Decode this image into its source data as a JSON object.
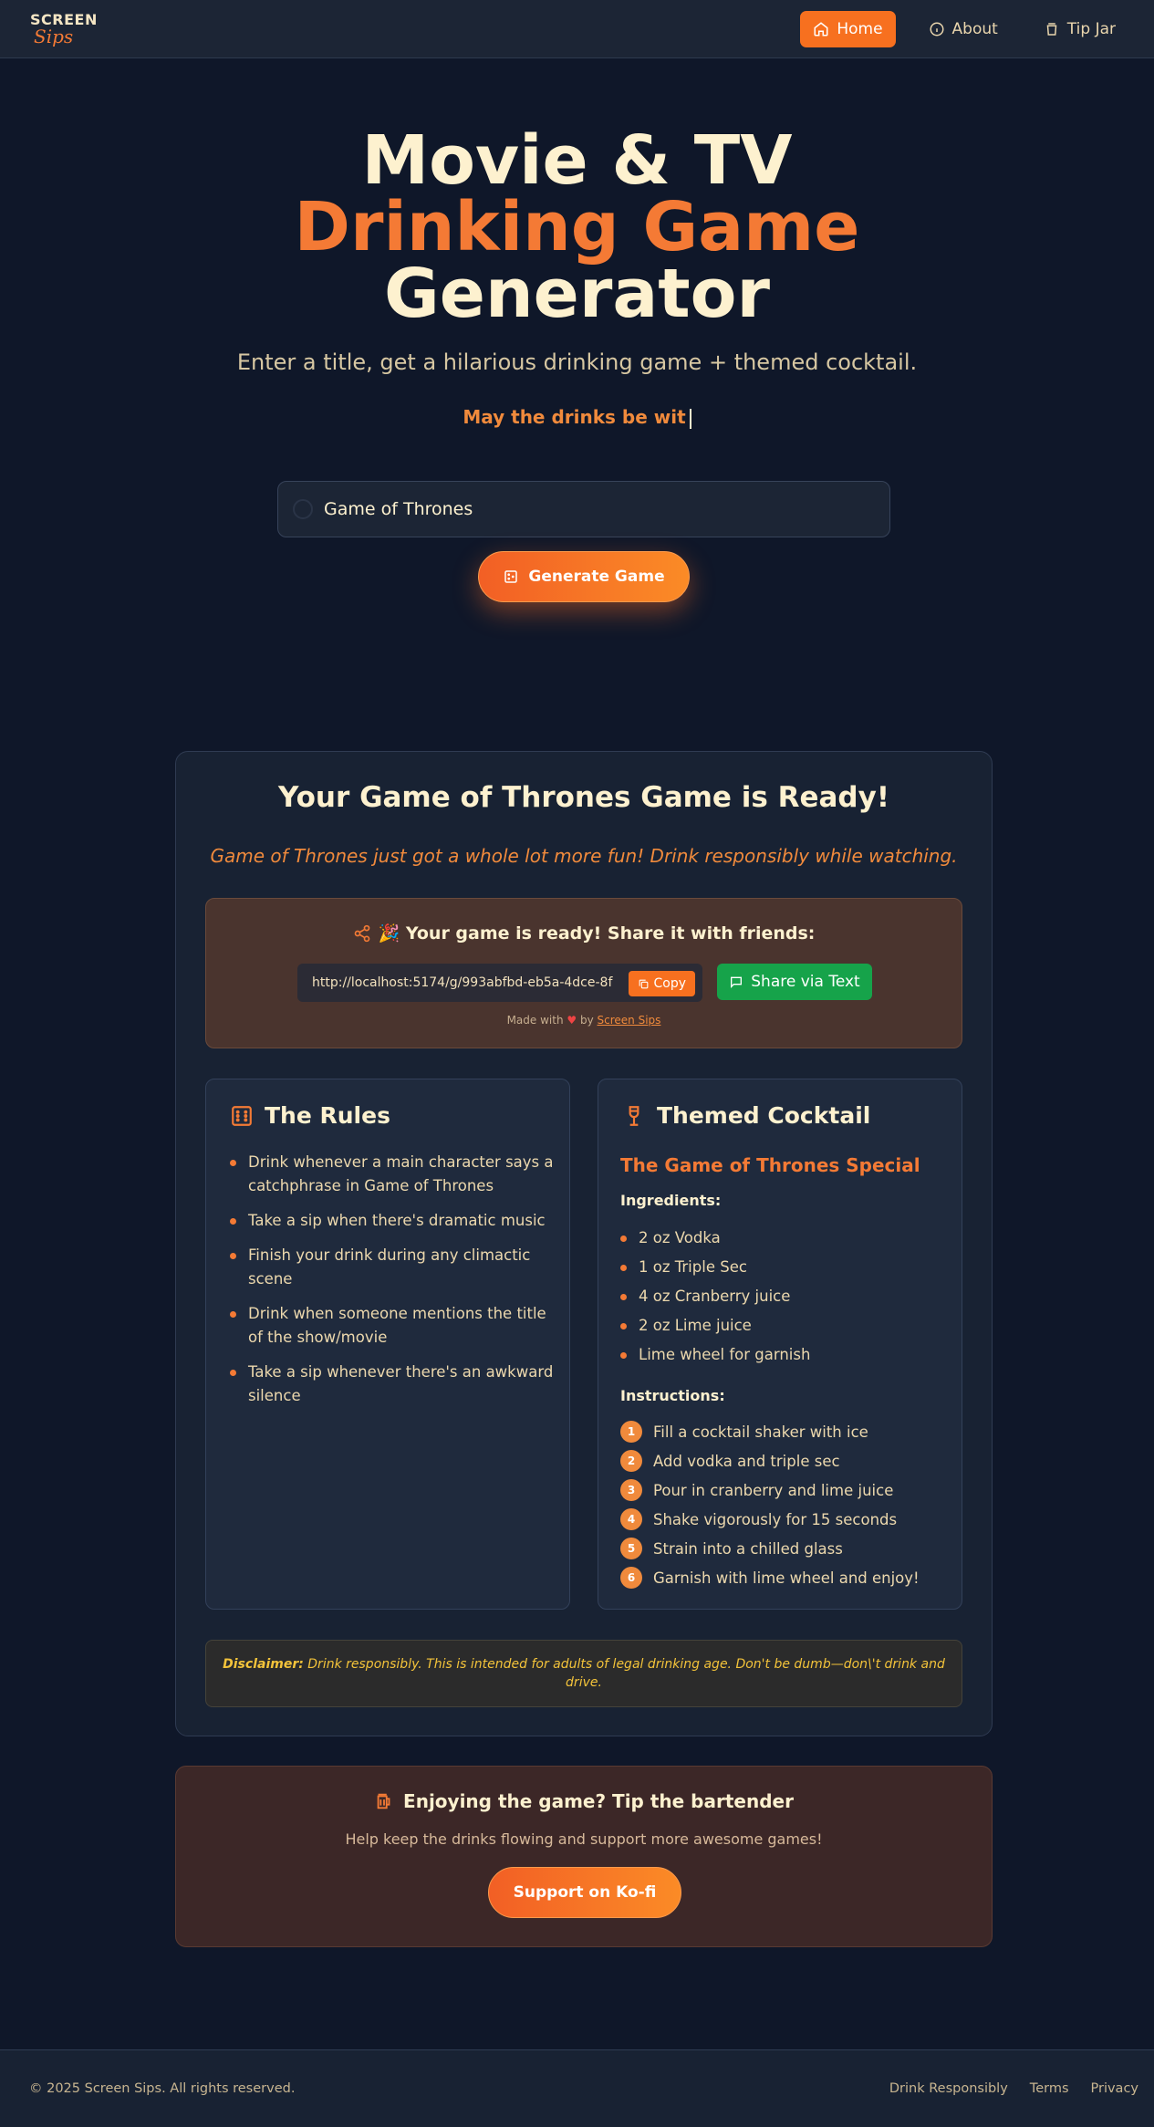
{
  "nav": {
    "logo_top": "SCREEN",
    "logo_bottom": "Sips",
    "links": [
      {
        "label": "Home",
        "icon": "home-icon",
        "active": true
      },
      {
        "label": "About",
        "icon": "info-icon",
        "active": false
      },
      {
        "label": "Tip Jar",
        "icon": "tip-jar-icon",
        "active": false
      }
    ]
  },
  "hero": {
    "title_line1": "Movie & TV",
    "title_line2": "Drinking Game",
    "title_line3": "Generator",
    "subtitle": "Enter a title, get a hilarious drinking game + themed cocktail.",
    "typing_text": "May the drinks be wit",
    "search_value": "Game of Thrones",
    "generate_label": "Generate Game"
  },
  "result": {
    "title": "Your Game of Thrones Game is Ready!",
    "tagline": "Game of Thrones just got a whole lot more fun! Drink responsibly while watching.",
    "share": {
      "heading": "🎉 Your game is ready! Share it with friends:",
      "url": "http://localhost:5174/g/993abfbd-eb5a-4dce-8f",
      "copy_label": "Copy",
      "sms_label": "Share via Text",
      "made_with_prefix": "Made with",
      "made_with_by": "by",
      "made_with_link": "Screen Sips"
    },
    "rules": {
      "heading": "The Rules",
      "items": [
        "Drink whenever a main character says a catchphrase in Game of Thrones",
        "Take a sip when there's dramatic music",
        "Finish your drink during any climactic scene",
        "Drink when someone mentions the title of the show/movie",
        "Take a sip whenever there's an awkward silence"
      ]
    },
    "cocktail": {
      "heading": "Themed Cocktail",
      "name": "The Game of Thrones Special",
      "ingredients_label": "Ingredients:",
      "ingredients": [
        "2 oz Vodka",
        "1 oz Triple Sec",
        "4 oz Cranberry juice",
        "2 oz Lime juice",
        "Lime wheel for garnish"
      ],
      "instructions_label": "Instructions:",
      "instructions": [
        "Fill a cocktail shaker with ice",
        "Add vodka and triple sec",
        "Pour in cranberry and lime juice",
        "Shake vigorously for 15 seconds",
        "Strain into a chilled glass",
        "Garnish with lime wheel and enjoy!"
      ]
    },
    "disclaimer_label": "Disclaimer:",
    "disclaimer_text": "Drink responsibly. This is intended for adults of legal drinking age. Don't be dumb—don\\'t drink and drive."
  },
  "tip": {
    "heading": "Enjoying the game? Tip the bartender",
    "subtitle": "Help keep the drinks flowing and support more awesome games!",
    "button": "Support on Ko-fi"
  },
  "footer": {
    "copyright": "© 2025 Screen Sips. All rights reserved.",
    "links": [
      "Drink Responsibly",
      "Terms",
      "Privacy"
    ]
  },
  "colors": {
    "background": "#0f1729",
    "accent": "#f47a35",
    "cream": "#fdf1cf",
    "share_green": "#16a34a"
  }
}
